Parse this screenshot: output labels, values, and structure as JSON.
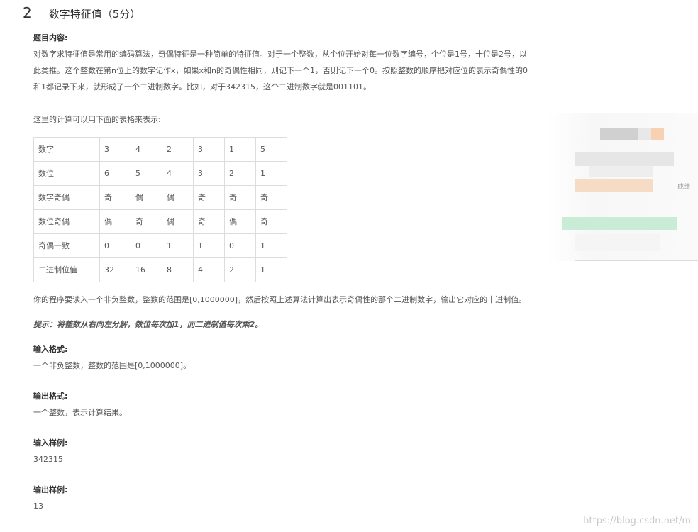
{
  "heading": {
    "number": "2",
    "title": "数字特征值（5分）"
  },
  "intro": {
    "label": "题目内容:",
    "lines": [
      "对数字求特征值是常用的编码算法，奇偶特征是一种简单的特征值。对于一个整数，从个位开始对每一位数字编号，个位是1号，十位是2号，以",
      "此类推。这个整数在第n位上的数字记作x，如果x和n的奇偶性相同，则记下一个1，否则记下一个0。按照整数的顺序把对应位的表示奇偶性的0",
      "和1都记录下来，就形成了一个二进制数字。比如，对于342315，这个二进制数字就是001101。"
    ],
    "table_intro": "这里的计算可以用下面的表格来表示:"
  },
  "table": {
    "rows": [
      {
        "head": "数字",
        "cells": [
          "3",
          "4",
          "2",
          "3",
          "1",
          "5"
        ]
      },
      {
        "head": "数位",
        "cells": [
          "6",
          "5",
          "4",
          "3",
          "2",
          "1"
        ]
      },
      {
        "head": "数字奇偶",
        "cells": [
          "奇",
          "偶",
          "偶",
          "奇",
          "奇",
          "奇"
        ]
      },
      {
        "head": "数位奇偶",
        "cells": [
          "偶",
          "奇",
          "偶",
          "奇",
          "偶",
          "奇"
        ]
      },
      {
        "head": "奇偶一致",
        "cells": [
          "0",
          "0",
          "1",
          "1",
          "0",
          "1"
        ]
      },
      {
        "head": "二进制位值",
        "cells": [
          "32",
          "16",
          "8",
          "4",
          "2",
          "1"
        ]
      }
    ]
  },
  "program_desc": "你的程序要读入一个非负整数，整数的范围是[0,1000000]，然后按照上述算法计算出表示奇偶性的那个二进制数字，输出它对应的十进制值。",
  "hint": "提示：将整数从右向左分解，数位每次加1，而二进制值每次乘2。",
  "input_format": {
    "label": "输入格式:",
    "text": "一个非负整数，整数的范围是[0,1000000]。"
  },
  "output_format": {
    "label": "输出格式:",
    "text": "一个整数，表示计算结果。"
  },
  "input_sample": {
    "label": "输入样例:",
    "text": "342315"
  },
  "output_sample": {
    "label": "输出样例:",
    "text": "13"
  },
  "watermark": "https://blog.csdn.net/m",
  "blurred_text": "成绩"
}
